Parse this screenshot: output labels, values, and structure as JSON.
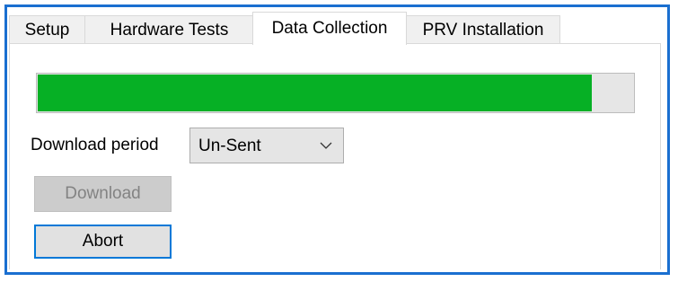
{
  "tabs": [
    {
      "label": "Setup"
    },
    {
      "label": "Hardware Tests"
    },
    {
      "label": "Data Collection"
    },
    {
      "label": "PRV Installation"
    }
  ],
  "active_tab": "Data Collection",
  "progress": {
    "fraction": 0.93,
    "fill_color": "#06b025"
  },
  "download_period": {
    "label": "Download period",
    "selected": "Un-Sent"
  },
  "buttons": {
    "download": {
      "label": "Download",
      "enabled": false
    },
    "abort": {
      "label": "Abort",
      "enabled": true
    }
  },
  "colors": {
    "frame_border": "#1a6fd0",
    "focus_border": "#0078d7"
  }
}
